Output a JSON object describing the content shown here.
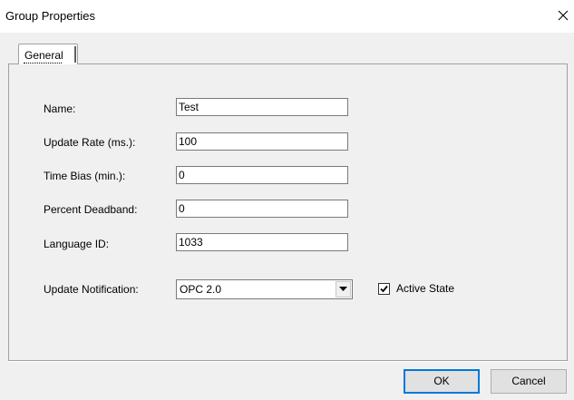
{
  "window": {
    "title": "Group Properties",
    "close_icon": "close-icon"
  },
  "tabs": [
    {
      "label": "General",
      "active": true
    }
  ],
  "form": {
    "name_label": "Name:",
    "name_value": "Test",
    "update_rate_label": "Update Rate (ms.):",
    "update_rate_value": "100",
    "time_bias_label": "Time Bias (min.):",
    "time_bias_value": "0",
    "percent_deadband_label": "Percent Deadband:",
    "percent_deadband_value": "0",
    "language_id_label": "Language ID:",
    "language_id_value": "1033",
    "update_notification_label": "Update Notification:",
    "update_notification_value": "OPC 2.0",
    "active_state_label": "Active State",
    "active_state_checked": true
  },
  "buttons": {
    "ok_label": "OK",
    "cancel_label": "Cancel"
  },
  "colors": {
    "dialog_bg": "#f0f0f0",
    "title_bg": "#ffffff",
    "focus_border": "#0078d7"
  }
}
